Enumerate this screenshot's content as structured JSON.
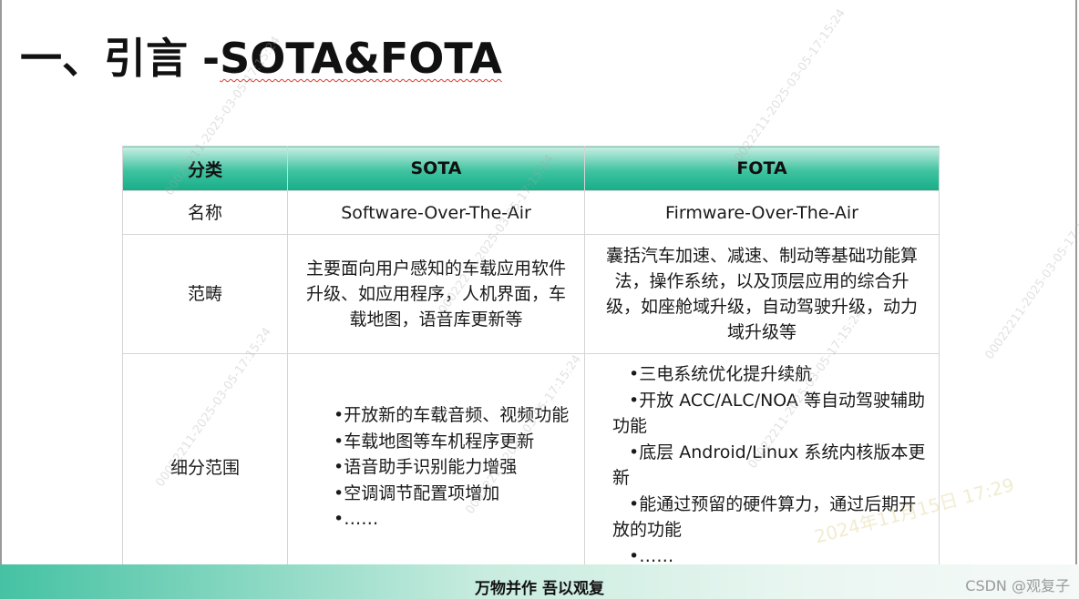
{
  "title": {
    "main": "一、引言 -",
    "underlined": "SOTA&FOTA"
  },
  "table": {
    "headers": [
      "分类",
      "SOTA",
      "FOTA"
    ],
    "rows": {
      "name": {
        "label": "名称",
        "sota": "Software-Over-The-Air",
        "fota": "Firmware-Over-The-Air"
      },
      "scope": {
        "label": "范畴",
        "sota": "主要面向用户感知的车载应用软件升级、如应用程序，人机界面，车载地图，语音库更新等",
        "fota": "囊括汽车加速、减速、制动等基础功能算法，操作系统，以及顶层应用的综合升级，如座舱域升级，自动驾驶升级，动力域升级等"
      },
      "detail": {
        "label": "细分范围",
        "sota": [
          "•开放新的车载音频、视频功能",
          "•车载地图等车机程序更新",
          "•语音助手识别能力增强",
          "•空调调节配置项增加",
          "•……"
        ],
        "fota": [
          "•三电系统优化提升续航",
          "•开放 ACC/ALC/NOA 等自动驾驶辅助功能",
          "•底层 Android/Linux 系统内核版本更新",
          "•能通过预留的硬件算力，通过后期开放的功能",
          "•……"
        ]
      }
    }
  },
  "footer": {
    "slogan": "万物并作 吾以观复"
  },
  "csdn_watermark": "CSDN @观复子",
  "watermark_id": "00022211-2025-03-05-17:15:24",
  "overlay_date": "2024年11月15日 17:29"
}
